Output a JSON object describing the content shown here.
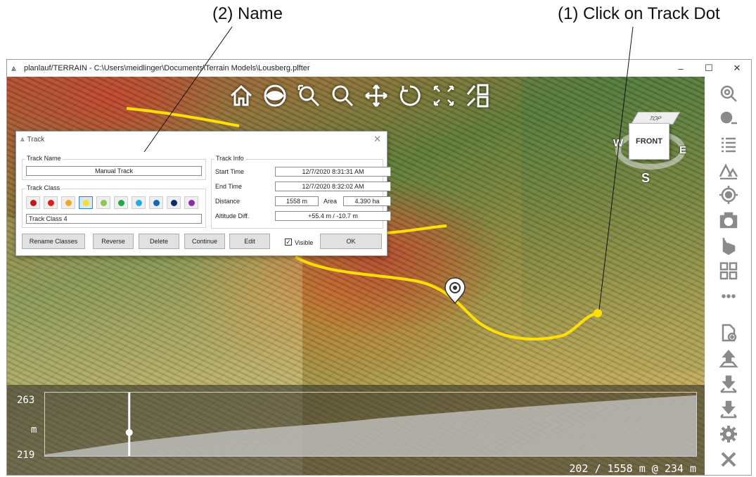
{
  "annotations": {
    "name_callout": "(2) Name",
    "dot_callout": "(1) Click on Track Dot"
  },
  "window": {
    "title": "planlauf/TERRAIN - C:\\Users\\meidlinger\\Documents\\Terrain Models\\Lousberg.plfter",
    "minimize": "–",
    "maximize": "☐",
    "close": "✕"
  },
  "toolbar_icons": [
    "home-icon",
    "eye-icon",
    "zoom-extent-icon",
    "zoom-icon",
    "pan-icon",
    "rotate-icon",
    "fullscreen-icon",
    "layout-icon"
  ],
  "view_cube": {
    "top": "TOP",
    "front": "FRONT",
    "west": "W",
    "east": "E",
    "south": "S"
  },
  "dialog": {
    "title": "Track",
    "track_name_group": "Track Name",
    "track_name": "Manual Track",
    "track_class_group": "Track Class",
    "class_colors": [
      "#c0161c",
      "#e01b1b",
      "#f5a623",
      "#f0e028",
      "#8cc84b",
      "#1fa94c",
      "#29a8e0",
      "#1666c0",
      "#0d2b66",
      "#8a2ea8"
    ],
    "selected_class_index": 3,
    "class_name": "Track Class 4",
    "track_info_group": "Track Info",
    "start_time_label": "Start Time",
    "start_time": "12/7/2020 8:31:31 AM",
    "end_time_label": "End Time",
    "end_time": "12/7/2020 8:32:02 AM",
    "distance_label": "Distance",
    "distance": "1558 m",
    "area_label": "Area",
    "area": "4.390 ha",
    "altitude_label": "Altitude Diff.",
    "altitude": "+55.4 m / -10.7 m",
    "buttons": {
      "rename": "Rename Classes",
      "reverse": "Reverse",
      "delete": "Delete",
      "continue": "Continue",
      "edit": "Edit",
      "ok": "OK"
    },
    "visible_label": "Visible",
    "visible_checked": true
  },
  "right_toolbar_icons": [
    "search-location-icon",
    "search-minus-icon",
    "list-icon",
    "terrain-icon",
    "locate-icon",
    "camera-icon",
    "bing-icon",
    "grid-icon",
    "more-icon",
    "new-file-icon",
    "upload-icon",
    "download-icon",
    "download-alt-icon",
    "settings-icon",
    "close-icon"
  ],
  "profile": {
    "y_max": "263",
    "y_unit": "m",
    "y_min": "219",
    "readout": "202 / 1558 m @ 234 m"
  },
  "colors": {
    "track": "#ffe000",
    "accent": "#2b7fd6"
  }
}
